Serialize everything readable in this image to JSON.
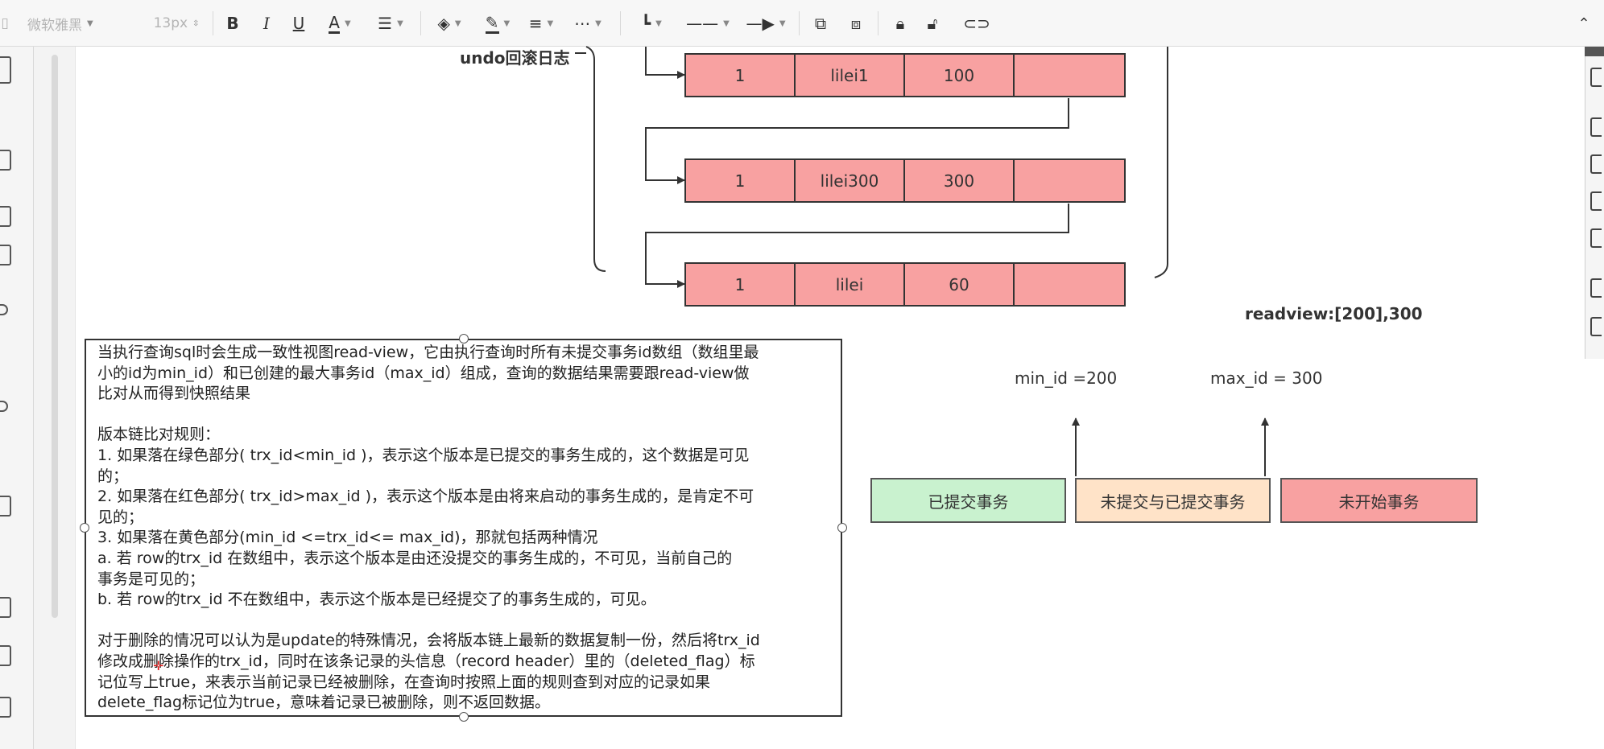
{
  "toolbar": {
    "font_name": "微软雅黑",
    "font_size": "13px",
    "bold": "B",
    "italic": "I",
    "underline": "U",
    "font_color": "A"
  },
  "diagram": {
    "undo_label": "undo回滚日志",
    "records": [
      {
        "id": "1",
        "name": "lilei1",
        "value": "100",
        "extra": ""
      },
      {
        "id": "1",
        "name": "lilei300",
        "value": "300",
        "extra": ""
      },
      {
        "id": "1",
        "name": "lilei",
        "value": "60",
        "extra": ""
      }
    ],
    "readview_label": "readview:[200],300",
    "min_id_label": "min_id =200",
    "max_id_label": "max_id = 300",
    "segments": [
      {
        "label": "已提交事务",
        "color": "#c9f2cf"
      },
      {
        "label": "未提交与已提交事务",
        "color": "#ffe3c8"
      },
      {
        "label": "未开始事务",
        "color": "#f8a1a1"
      }
    ]
  },
  "note": {
    "lines": [
      "当执行查询sql时会生成一致性视图read-view，它由执行查询时所有未提交事务id数组（数组里最",
      "小的id为min_id）和已创建的最大事务id（max_id）组成，查询的数据结果需要跟read-view做",
      "比对从而得到快照结果",
      "",
      "版本链比对规则：",
      "1. 如果落在绿色部分( trx_id<min_id )，表示这个版本是已提交的事务生成的，这个数据是可见",
      "的；",
      "2. 如果落在红色部分( trx_id>max_id )，表示这个版本是由将来启动的事务生成的，是肯定不可",
      "见的；",
      "3. 如果落在黄色部分(min_id <=trx_id<= max_id)，那就包括两种情况",
      "    a. 若 row的trx_id 在数组中，表示这个版本是由还没提交的事务生成的，不可见，当前自己的",
      "事务是可见的；",
      "    b. 若 row的trx_id 不在数组中，表示这个版本是已经提交了的事务生成的，可见。",
      "",
      "对于删除的情况可以认为是update的特殊情况，会将版本链上最新的数据复制一份，然后将trx_id",
      "修改成删除操作的trx_id，同时在该条记录的头信息（record header）里的（deleted_flag）标",
      "记位写上true，来表示当前记录已经被删除，在查询时按照上面的规则查到对应的记录如果",
      "delete_flag标记位为true，意味着记录已被删除，则不返回数据。"
    ]
  },
  "colors": {
    "record_fill": "#f8a1a1",
    "green": "#c9f2cf",
    "yellow": "#ffe3c8",
    "red": "#f8a1a1"
  }
}
